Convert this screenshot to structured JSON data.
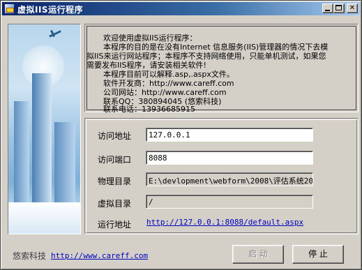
{
  "window": {
    "title": "虚拟IIS运行程序"
  },
  "info": {
    "lines": [
      "欢迎使用虚拟IIS运行程序：",
      "本程序的目的是在没有Internet 信息服务(IIS)管理器的情况下去模",
      "拟IIS来运行网站程序；本程序不支持网络使用，只能单机测试，如果您",
      "需要发布IIS程序，请安装相关软件!",
      "本程序目前可以解释.asp,.aspx文件。",
      "软件开发商：http://www.careff.com",
      "公司网站：http://www.careff.com",
      "联系QQ：380894045 (悠索科技)",
      "联系电话：13936685915"
    ]
  },
  "form": {
    "address_label": "访问地址",
    "address_value": "127.0.0.1",
    "port_label": "访问端口",
    "port_value": "8088",
    "physical_label": "物理目录",
    "physical_value": "E:\\devlopment\\webform\\2008\\评估系统2010",
    "virtual_label": "虚拟目录",
    "virtual_value": "/",
    "run_label": "运行地址",
    "run_url": "http://127.0.0.1:8088/default.aspx"
  },
  "footer": {
    "company": "悠索科技",
    "website": "http://www.careff.com"
  },
  "buttons": {
    "start_label": "启 动",
    "stop_label": "停 止"
  }
}
